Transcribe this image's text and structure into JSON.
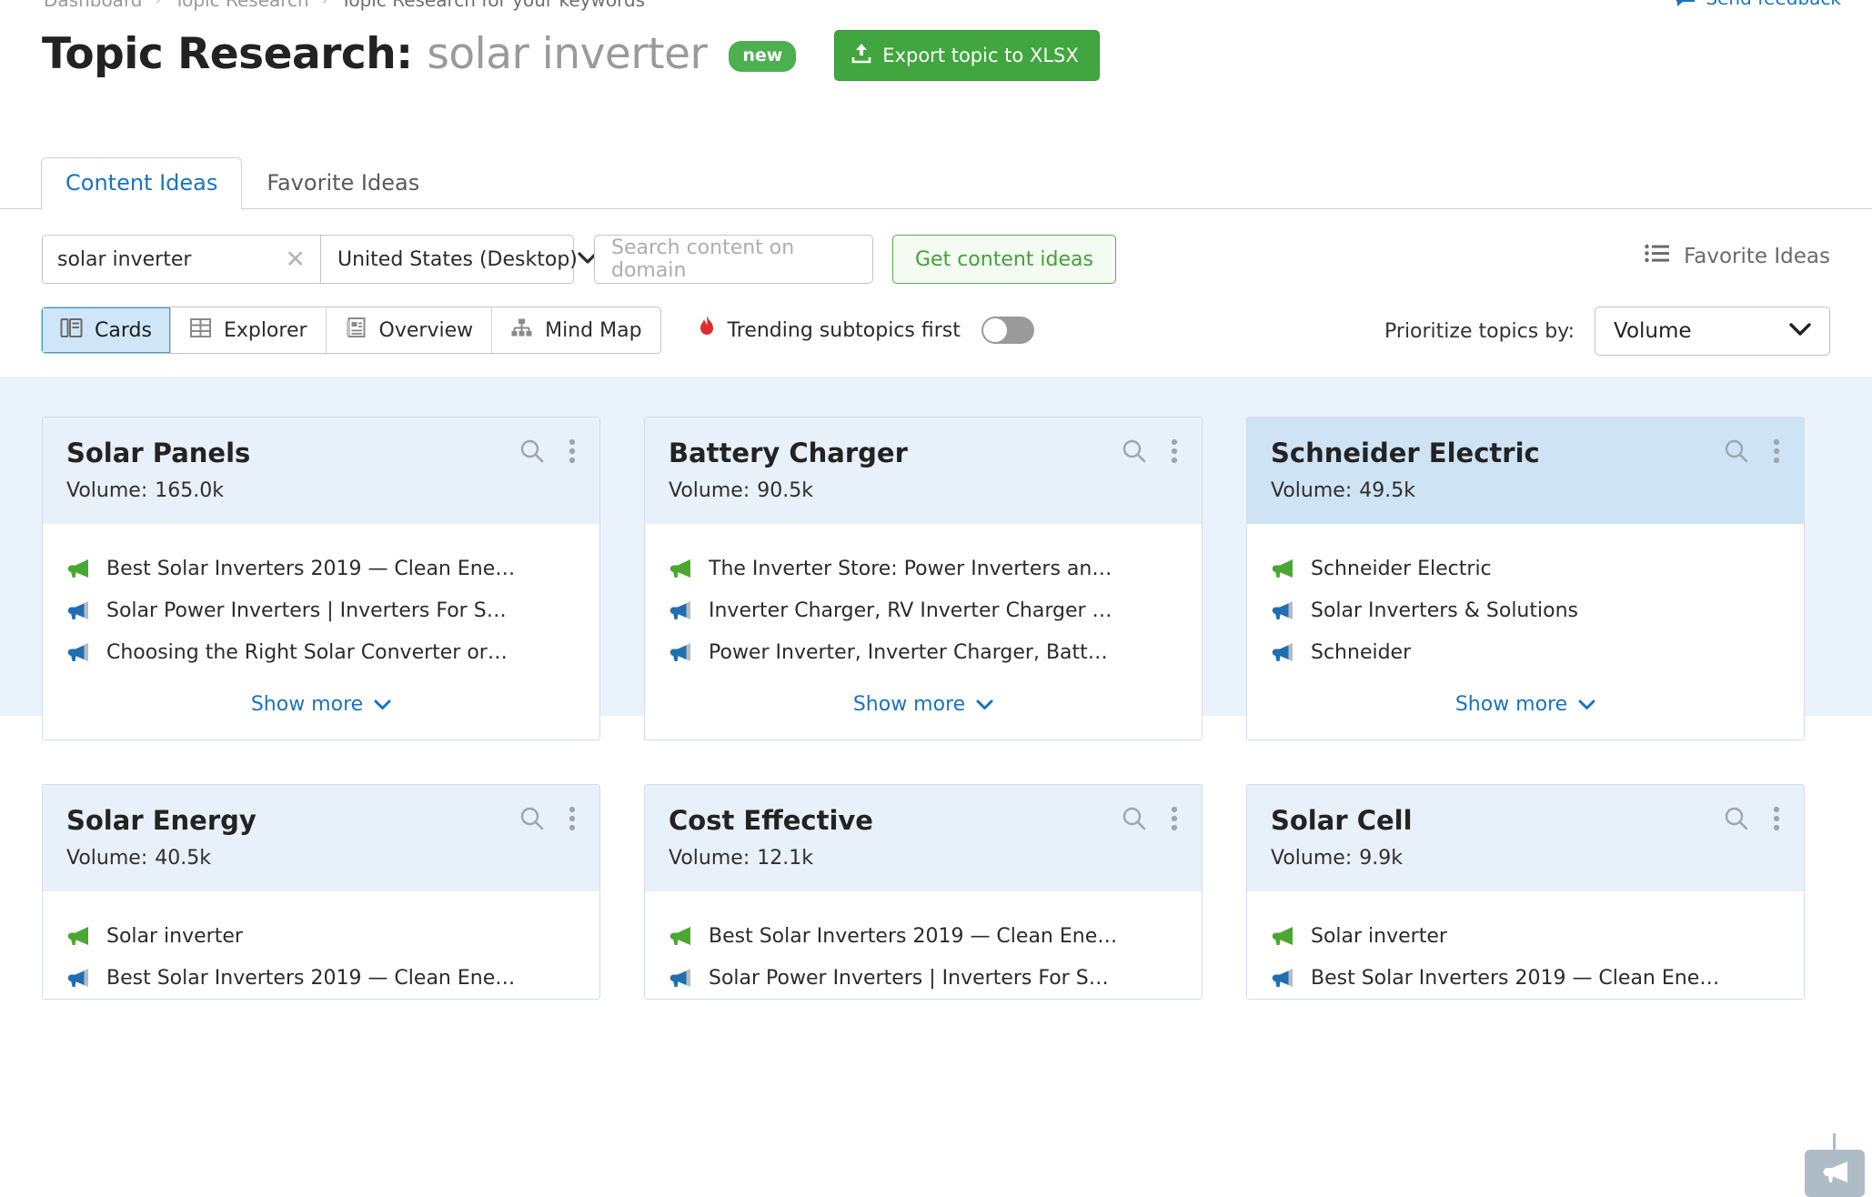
{
  "breadcrumb": {
    "items": [
      "Dashboard",
      "Topic Research",
      "Topic Research for your keywords"
    ],
    "separator": "›"
  },
  "feedback": {
    "label": "Send feedback",
    "icon": "speech-bubble-icon"
  },
  "header": {
    "title_prefix": "Topic Research:",
    "keyword": "solar inverter",
    "badge": "new",
    "export_label": "Export topic to XLSX",
    "export_icon": "upload-icon",
    "export_color": "#41a63f"
  },
  "tabs": [
    {
      "label": "Content Ideas",
      "active": true
    },
    {
      "label": "Favorite Ideas",
      "active": false
    }
  ],
  "search": {
    "keyword_value": "solar inverter",
    "clear_icon": "close-x-icon",
    "database_value": "United States (Desktop)",
    "database_chevron": "chevron-down-icon",
    "domain_placeholder": "Search content on domain",
    "get_ideas_label": "Get content ideas",
    "favorite_ideas_label": "Favorite Ideas",
    "favorite_ideas_icon": "list-icon"
  },
  "view_modes": [
    {
      "label": "Cards",
      "icon": "cards-icon",
      "active": true
    },
    {
      "label": "Explorer",
      "icon": "table-icon",
      "active": false
    },
    {
      "label": "Overview",
      "icon": "document-icon",
      "active": false
    },
    {
      "label": "Mind Map",
      "icon": "hierarchy-icon",
      "active": false
    }
  ],
  "trending": {
    "label": "Trending subtopics first",
    "icon": "flame-icon",
    "icon_color": "#e02b2b",
    "enabled": false
  },
  "prioritize": {
    "label": "Prioritize topics by:",
    "value": "Volume",
    "chevron": "chevron-down-icon"
  },
  "cards": [
    {
      "title": "Solar Panels",
      "volume_label": "Volume:",
      "volume": "165.0k",
      "highlighted": false,
      "search_icon": "search-icon",
      "menu_icon": "kebab-menu-icon",
      "ideas": [
        {
          "text": "Best Solar Inverters 2019 — Clean Ene…",
          "icon": "megaphone-green-icon"
        },
        {
          "text": "Solar Power Inverters | Inverters For S…",
          "icon": "megaphone-blue-icon"
        },
        {
          "text": "Choosing the Right Solar Converter or…",
          "icon": "megaphone-blue-icon"
        }
      ],
      "show_more": "Show more"
    },
    {
      "title": "Battery Charger",
      "volume_label": "Volume:",
      "volume": "90.5k",
      "highlighted": false,
      "search_icon": "search-icon",
      "menu_icon": "kebab-menu-icon",
      "ideas": [
        {
          "text": "The Inverter Store: Power Inverters an…",
          "icon": "megaphone-green-icon"
        },
        {
          "text": "Inverter Charger, RV Inverter Charger …",
          "icon": "megaphone-blue-icon"
        },
        {
          "text": "Power Inverter, Inverter Charger, Batt…",
          "icon": "megaphone-blue-icon"
        }
      ],
      "show_more": "Show more"
    },
    {
      "title": "Schneider Electric",
      "volume_label": "Volume:",
      "volume": "49.5k",
      "highlighted": true,
      "search_icon": "search-icon",
      "menu_icon": "kebab-menu-icon",
      "ideas": [
        {
          "text": "Schneider Electric",
          "icon": "megaphone-green-icon"
        },
        {
          "text": "Solar Inverters & Solutions",
          "icon": "megaphone-blue-icon"
        },
        {
          "text": "Schneider",
          "icon": "megaphone-blue-icon"
        }
      ],
      "show_more": "Show more"
    },
    {
      "title": "Solar Energy",
      "volume_label": "Volume:",
      "volume": "40.5k",
      "highlighted": false,
      "search_icon": "search-icon",
      "menu_icon": "kebab-menu-icon",
      "ideas": [
        {
          "text": "Solar inverter",
          "icon": "megaphone-green-icon"
        },
        {
          "text": "Best Solar Inverters 2019 — Clean Ene…",
          "icon": "megaphone-blue-icon"
        }
      ],
      "show_more": ""
    },
    {
      "title": "Cost Effective",
      "volume_label": "Volume:",
      "volume": "12.1k",
      "highlighted": false,
      "search_icon": "search-icon",
      "menu_icon": "kebab-menu-icon",
      "ideas": [
        {
          "text": "Best Solar Inverters 2019 — Clean Ene…",
          "icon": "megaphone-green-icon"
        },
        {
          "text": "Solar Power Inverters | Inverters For S…",
          "icon": "megaphone-blue-icon"
        }
      ],
      "show_more": ""
    },
    {
      "title": "Solar Cell",
      "volume_label": "Volume:",
      "volume": "9.9k",
      "highlighted": false,
      "search_icon": "search-icon",
      "menu_icon": "kebab-menu-icon",
      "ideas": [
        {
          "text": "Solar inverter",
          "icon": "megaphone-green-icon"
        },
        {
          "text": "Best Solar Inverters 2019 — Clean Ene…",
          "icon": "megaphone-blue-icon"
        }
      ],
      "show_more": ""
    }
  ],
  "floating_widget": {
    "icon": "megaphone-widget-icon"
  }
}
